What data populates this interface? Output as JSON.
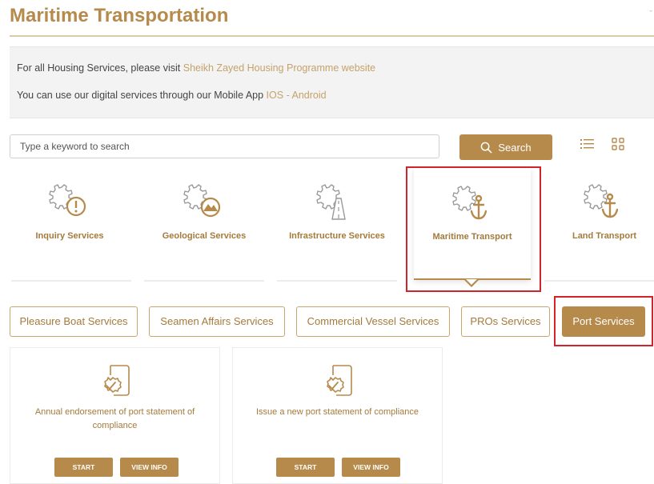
{
  "page": {
    "title": "Maritime Transportation",
    "corner_mark": "ˇ"
  },
  "notice": {
    "line1_text": "For all Housing Services, please visit ",
    "line1_link": "Sheikh Zayed Housing Programme website",
    "line2_text": "You can use our digital services through our Mobile App ",
    "line2_link_ios": "IOS",
    "line2_sep": " - ",
    "line2_link_android": "Android"
  },
  "search": {
    "placeholder": "Type a keyword to search",
    "button_label": "Search"
  },
  "categories": [
    {
      "label": "Inquiry Services",
      "icon": "gear-exclamation-icon"
    },
    {
      "label": "Geological Services",
      "icon": "gear-mountain-icon"
    },
    {
      "label": "Infrastructure Services",
      "icon": "gear-road-icon"
    },
    {
      "label": "Maritime Transport",
      "icon": "gear-anchor-icon",
      "active": true
    },
    {
      "label": "Land Transport",
      "icon": "gear-anchor-icon"
    }
  ],
  "subtabs": [
    {
      "label": "Pleasure Boat Services"
    },
    {
      "label": "Seamen Affairs Services"
    },
    {
      "label": "Commercial Vessel Services"
    },
    {
      "label": "PROs Services"
    },
    {
      "label": "Port Services",
      "active": true
    }
  ],
  "services": [
    {
      "title": "Annual endorsement of port statement of compliance",
      "start_label": "START",
      "info_label": "VIEW INFO"
    },
    {
      "title": "Issue a new port statement of compliance",
      "start_label": "START",
      "info_label": "VIEW INFO"
    }
  ],
  "colors": {
    "accent": "#b68a4b",
    "highlight": "#d2232a",
    "notice_bg": "#f3f3f3"
  }
}
